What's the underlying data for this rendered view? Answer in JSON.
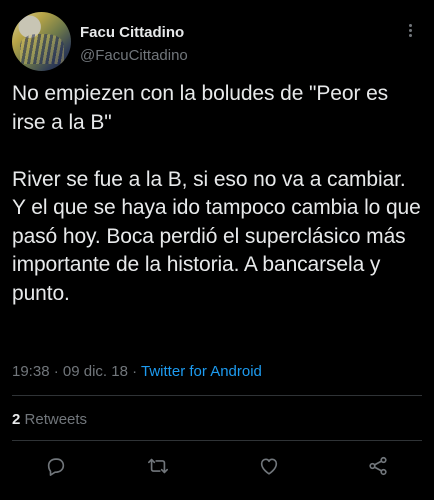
{
  "user": {
    "display_name": "Facu Cittadino",
    "handle": "@FacuCittadino"
  },
  "tweet": {
    "text": "No empiezen con la boludes de \"Peor es irse a la B\"\n\nRiver se fue a la B, si eso no va a cambiar. Y el que se haya ido tampoco cambia lo que pasó hoy. Boca perdió el superclásico más importante de la historia. A bancarsela y punto."
  },
  "meta": {
    "time": "19:38",
    "separator": "·",
    "date": "09 dic. 18",
    "source": "Twitter for Android"
  },
  "stats": {
    "retweets_count": "2",
    "retweets_label": "Retweets"
  },
  "icons": {
    "more": "more-icon",
    "reply": "reply-icon",
    "retweet": "retweet-icon",
    "like": "like-icon",
    "share": "share-icon"
  },
  "colors": {
    "background": "#000000",
    "text": "#e7e9ea",
    "secondary": "#71767b",
    "link": "#1d9bf0",
    "divider": "#2f3336"
  }
}
